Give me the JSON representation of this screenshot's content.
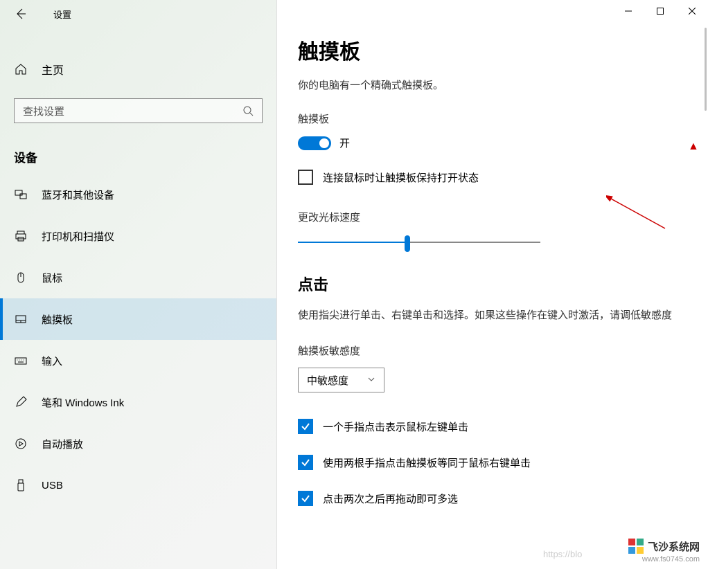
{
  "window": {
    "title": "设置"
  },
  "sidebar": {
    "home_label": "主页",
    "search_placeholder": "查找设置",
    "category": "设备",
    "items": [
      {
        "label": "蓝牙和其他设备",
        "icon": "bluetooth-devices-icon"
      },
      {
        "label": "打印机和扫描仪",
        "icon": "printer-icon"
      },
      {
        "label": "鼠标",
        "icon": "mouse-icon"
      },
      {
        "label": "触摸板",
        "icon": "touchpad-icon",
        "active": true
      },
      {
        "label": "输入",
        "icon": "keyboard-icon"
      },
      {
        "label": "笔和 Windows Ink",
        "icon": "pen-icon"
      },
      {
        "label": "自动播放",
        "icon": "autoplay-icon"
      },
      {
        "label": "USB",
        "icon": "usb-icon"
      }
    ]
  },
  "main": {
    "page_title": "触摸板",
    "subtitle": "你的电脑有一个精确式触摸板。",
    "touchpad_label": "触摸板",
    "toggle_state": "开",
    "checkbox_mouse_label": "连接鼠标时让触摸板保持打开状态",
    "checkbox_mouse_checked": false,
    "cursor_speed_label": "更改光标速度",
    "cursor_speed_value": 45,
    "taps_heading": "点击",
    "taps_description": "使用指尖进行单击、右键单击和选择。如果这些操作在键入时激活，请调低敏感度",
    "sensitivity_label": "触摸板敏感度",
    "sensitivity_value": "中敏感度",
    "checkboxes": [
      {
        "label": "一个手指点击表示鼠标左键单击",
        "checked": true
      },
      {
        "label": "使用两根手指点击触摸板等同于鼠标右键单击",
        "checked": true
      },
      {
        "label": "点击两次之后再拖动即可多选",
        "checked": true
      }
    ]
  },
  "watermark": {
    "brand": "飞沙系统网",
    "url": "www.fs0745.com",
    "faded": "https://blo"
  }
}
